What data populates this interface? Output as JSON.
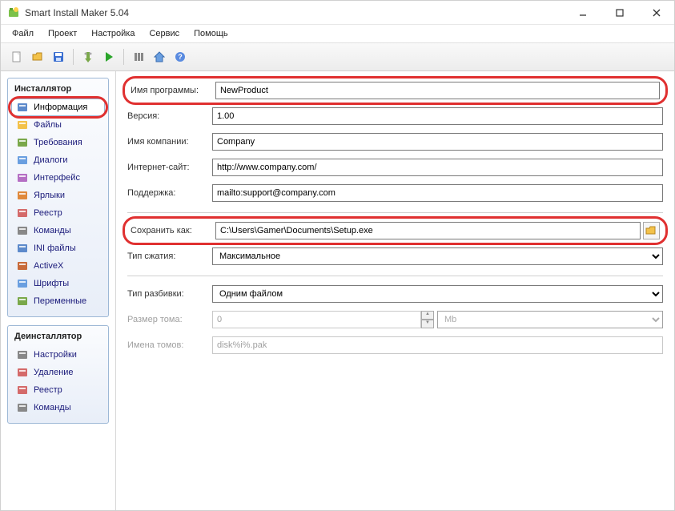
{
  "window": {
    "title": "Smart Install Maker 5.04"
  },
  "menubar": [
    "Файл",
    "Проект",
    "Настройка",
    "Сервис",
    "Помощь"
  ],
  "sidebar": {
    "installer_title": "Инсталлятор",
    "uninstaller_title": "Деинсталлятор",
    "installer_items": [
      {
        "label": "Информация",
        "active": true
      },
      {
        "label": "Файлы"
      },
      {
        "label": "Требования"
      },
      {
        "label": "Диалоги"
      },
      {
        "label": "Интерфейс"
      },
      {
        "label": "Ярлыки"
      },
      {
        "label": "Реестр"
      },
      {
        "label": "Команды"
      },
      {
        "label": "INI файлы"
      },
      {
        "label": "ActiveX"
      },
      {
        "label": "Шрифты"
      },
      {
        "label": "Переменные"
      }
    ],
    "uninstaller_items": [
      {
        "label": "Настройки"
      },
      {
        "label": "Удаление"
      },
      {
        "label": "Реестр"
      },
      {
        "label": "Команды"
      }
    ]
  },
  "form": {
    "program_name": {
      "label": "Имя программы:",
      "value": "NewProduct"
    },
    "version": {
      "label": "Версия:",
      "value": "1.00"
    },
    "company": {
      "label": "Имя компании:",
      "value": "Company"
    },
    "website": {
      "label": "Интернет-сайт:",
      "value": "http://www.company.com/"
    },
    "support": {
      "label": "Поддержка:",
      "value": "mailto:support@company.com"
    },
    "save_as": {
      "label": "Сохранить как:",
      "value": "C:\\Users\\Gamer\\Documents\\Setup.exe"
    },
    "compression": {
      "label": "Тип сжатия:",
      "value": "Максимальное"
    },
    "split_type": {
      "label": "Тип разбивки:",
      "value": "Одним файлом"
    },
    "volume_size": {
      "label": "Размер тома:",
      "value": "0",
      "unit": "Mb"
    },
    "volume_names": {
      "label": "Имена томов:",
      "value": "disk%i%.pak"
    }
  }
}
